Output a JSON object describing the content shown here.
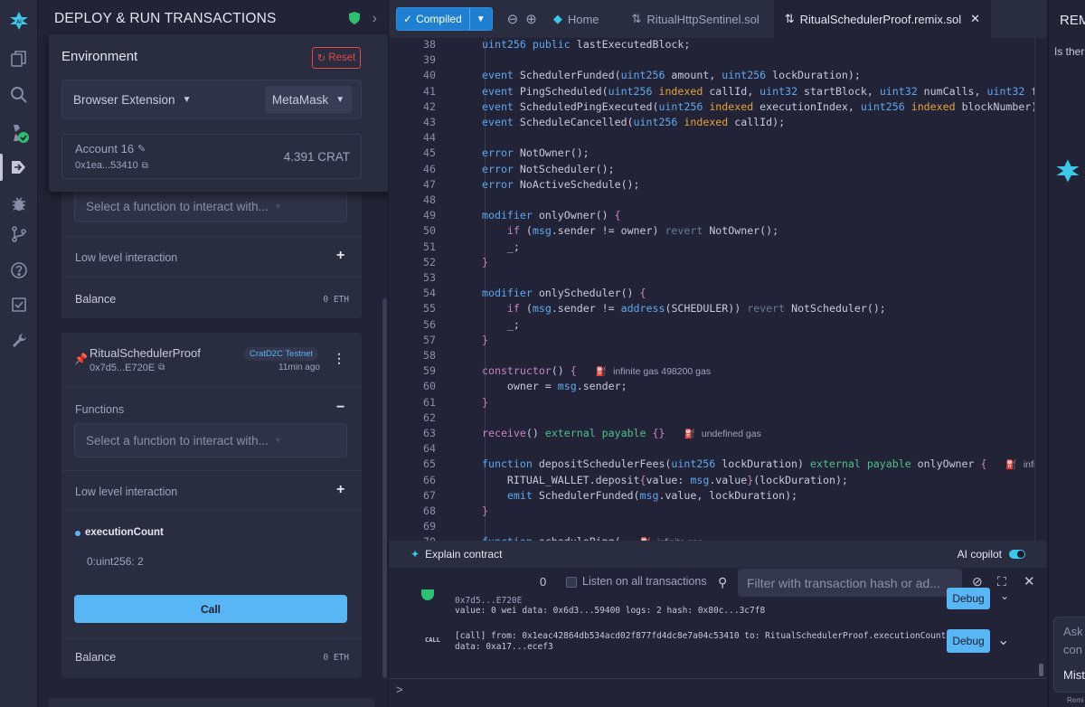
{
  "iconbar": {
    "icons": [
      "remix-logo-icon",
      "file-explorer-icon",
      "search-icon",
      "solidity-compiler-icon",
      "deploy-run-icon",
      "debugger-icon",
      "git-icon",
      "help-icon",
      "checklist-icon",
      "settings-wrench-icon"
    ]
  },
  "sidepanel": {
    "title": "DEPLOY & RUN TRANSACTIONS",
    "environment": {
      "label": "Environment",
      "reset": "Reset",
      "provider": "Browser Extension",
      "wallet": "MetaMask"
    },
    "account": {
      "name": "Account 16",
      "address": "0x1ea...53410",
      "balance": "4.391 CRAT"
    },
    "first_contract": {
      "select_placeholder": "Select a function to interact with...",
      "low_level": "Low level interaction",
      "balance_label": "Balance",
      "balance_value": "0 ETH"
    },
    "contract": {
      "name": "RitualSchedulerProof",
      "address": "0x7d5...E720E",
      "network": "CratD2C Testnet",
      "time": "11min ago",
      "functions_label": "Functions",
      "select_placeholder": "Select a function to interact with...",
      "low_level": "Low level interaction",
      "fn_name": "executionCount",
      "result_index": "0:",
      "result_value": "uint256: 2",
      "call": "Call",
      "balance_label": "Balance",
      "balance_value": "0 ETH"
    }
  },
  "tabs": {
    "compiled": "Compiled",
    "home": "Home",
    "file1": "RitualHttpSentinel.sol",
    "file2": "RitualSchedulerProof.remix.sol"
  },
  "editor": {
    "line_numbers": [
      "38",
      "39",
      "40",
      "41",
      "42",
      "43",
      "44",
      "45",
      "46",
      "47",
      "48",
      "49",
      "50",
      "51",
      "52",
      "53",
      "54",
      "55",
      "56",
      "57",
      "58",
      "59",
      "60",
      "61",
      "62",
      "63",
      "64",
      "65",
      "66",
      "67",
      "68",
      "69",
      "70"
    ],
    "gas": {
      "constructor": "infinite gas 498200 gas",
      "receive": "undefined gas",
      "deposit": "infinite",
      "schedule": "infinite gas"
    }
  },
  "terminal": {
    "explain": "Explain contract",
    "ai_copilot": "AI copilot",
    "count": "0",
    "listen": "Listen on all transactions",
    "filter_placeholder": "Filter with transaction hash or ad...",
    "tx1_addr": "0x7d5...E720E",
    "tx1_line": "value: 0 wei data: 0x6d3...59400 logs: 2 hash: 0x80c...3c7f8",
    "call_tag": "CALL",
    "tx2_line1": "[call] from: 0x1eac42864db534acd02f877fd4dc8e7a04c53410 to: RitualSchedulerProof.executionCount()",
    "tx2_line2": "data: 0xa17...ecef3",
    "debug": "Debug",
    "prompt": ">"
  },
  "rightpanel": {
    "title": "REM",
    "text": "Is ther",
    "ask": "Ask",
    "con": "con",
    "mist": "Mist",
    "rem": "Remi"
  }
}
